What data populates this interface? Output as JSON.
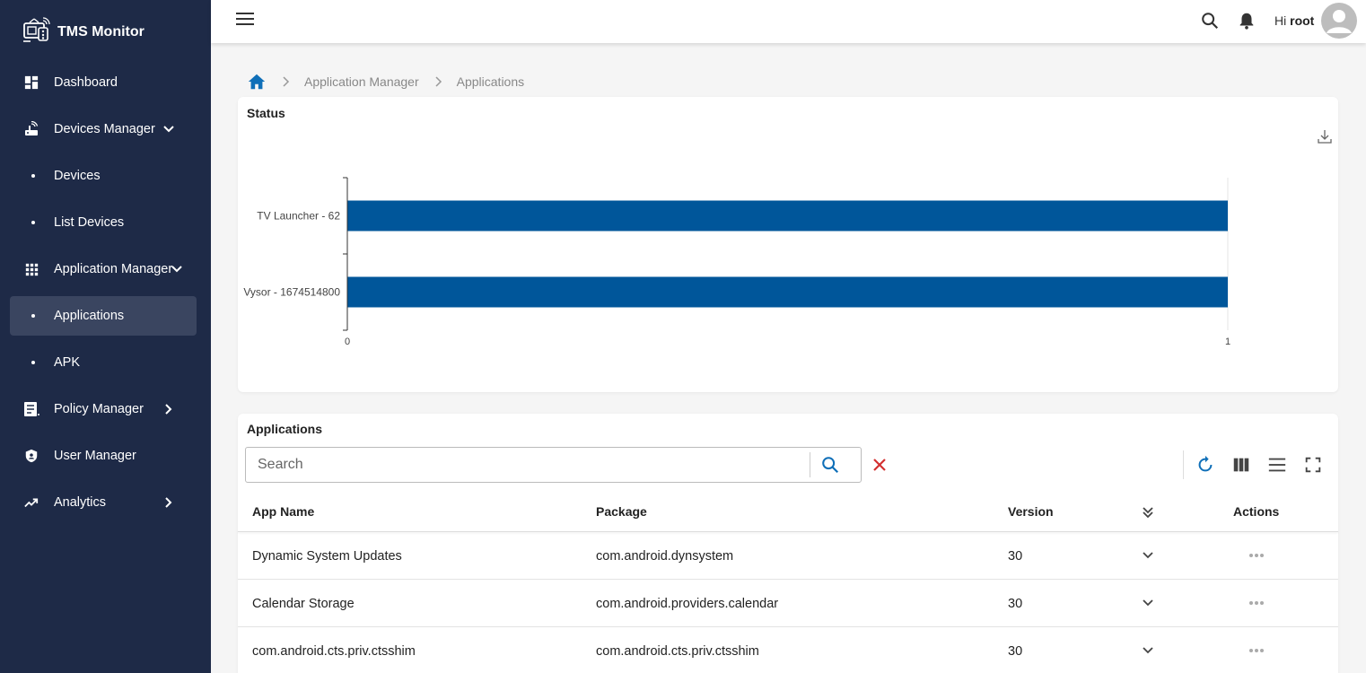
{
  "app": {
    "title": "TMS Monitor"
  },
  "sidebar": {
    "items": [
      {
        "label": "Dashboard"
      },
      {
        "label": "Devices Manager"
      },
      {
        "label": "Devices"
      },
      {
        "label": "List Devices"
      },
      {
        "label": "Application Manager"
      },
      {
        "label": "Applications"
      },
      {
        "label": "APK"
      },
      {
        "label": "Policy Manager"
      },
      {
        "label": "User Manager"
      },
      {
        "label": "Analytics"
      }
    ]
  },
  "header": {
    "greeting": "Hi",
    "username": "root"
  },
  "breadcrumb": {
    "items": [
      "Application Manager",
      "Applications"
    ]
  },
  "status_card": {
    "title": "Status"
  },
  "chart_data": {
    "type": "bar",
    "orientation": "horizontal",
    "categories": [
      "TV Launcher - 62",
      "Vysor - 1674514800"
    ],
    "values": [
      1,
      1
    ],
    "xlim": [
      0,
      1
    ],
    "xticks": [
      "0",
      "1"
    ],
    "color": "#00569a",
    "grid": false
  },
  "apps_card": {
    "title": "Applications",
    "search_placeholder": "Search",
    "columns": [
      "App Name",
      "Package",
      "Version",
      "Actions"
    ],
    "rows": [
      {
        "name": "Dynamic System Updates",
        "package": "com.android.dynsystem",
        "version": "30"
      },
      {
        "name": "Calendar Storage",
        "package": "com.android.providers.calendar",
        "version": "30"
      },
      {
        "name": "com.android.cts.priv.ctsshim",
        "package": "com.android.cts.priv.ctsshim",
        "version": "30"
      }
    ]
  },
  "colors": {
    "sidebar_bg": "#1e2a47",
    "accent": "#0f6fb8",
    "bar": "#00569a",
    "danger": "#d32f2f"
  }
}
